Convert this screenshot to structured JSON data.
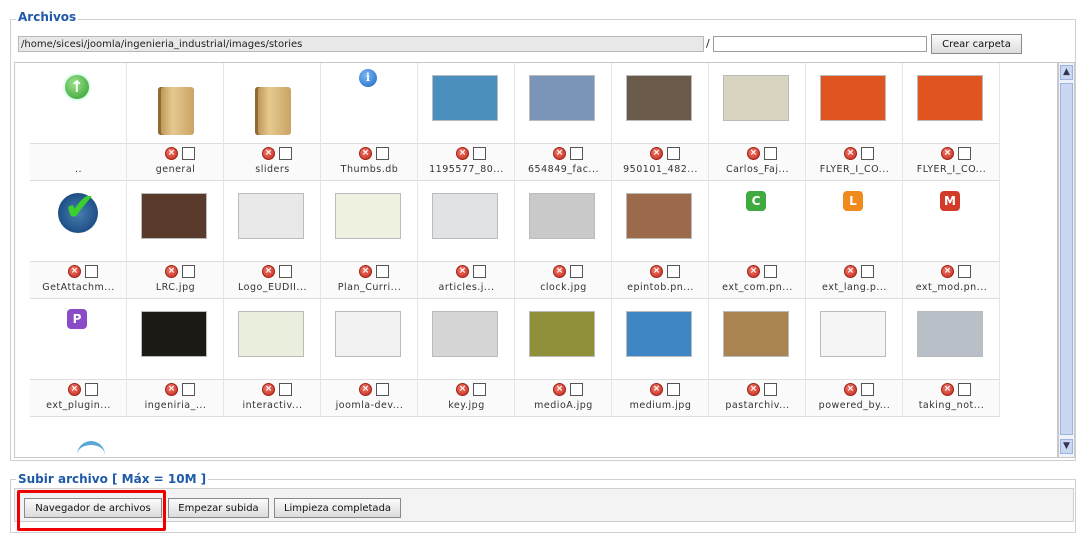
{
  "archivos": {
    "legend": "Archivos",
    "path": "/home/sicesi/joomla/ingenieria_industrial/images/stories",
    "slash": "/",
    "new_folder_value": "",
    "create_folder_label": "Crear carpeta"
  },
  "grid": {
    "rows": [
      [
        {
          "name": "..",
          "kind": "up",
          "icon": "up-arrow-icon",
          "actions": false
        },
        {
          "name": "general",
          "kind": "folder",
          "icon": "folder-icon",
          "actions": true
        },
        {
          "name": "sliders",
          "kind": "folder",
          "icon": "folder-icon",
          "actions": true
        },
        {
          "name": "Thumbs.db",
          "kind": "info",
          "icon": "info-icon",
          "actions": true
        },
        {
          "name": "1195577_80...",
          "kind": "photo",
          "icon": "handshake-photo",
          "color": "#4b8fbf",
          "actions": true
        },
        {
          "name": "654849_fac...",
          "kind": "photo",
          "icon": "factory-photo",
          "color": "#7b95b8",
          "actions": true
        },
        {
          "name": "950101_482...",
          "kind": "photo",
          "icon": "workers-photo",
          "color": "#6a5a4a",
          "actions": true
        },
        {
          "name": "Carlos_Faj...",
          "kind": "photo",
          "icon": "document-photo",
          "color": "#d9d4c0",
          "actions": true
        },
        {
          "name": "FLYER_I_CO...",
          "kind": "photo",
          "icon": "flyer-photo",
          "color": "#e0541f",
          "actions": true
        },
        {
          "name": "FLYER_I_CO...",
          "kind": "photo",
          "icon": "flyer-photo",
          "color": "#e0541f",
          "actions": true
        }
      ],
      [
        {
          "name": "GetAttachm...",
          "kind": "check",
          "icon": "checkmark-icon",
          "actions": true
        },
        {
          "name": "LRC.jpg",
          "kind": "photo",
          "icon": "portrait-photo",
          "color": "#5a3a2a",
          "actions": true
        },
        {
          "name": "Logo_EUDII...",
          "kind": "photo",
          "icon": "eudii-logo",
          "color": "#e8e8e8",
          "actions": true
        },
        {
          "name": "Plan_Curri...",
          "kind": "photo",
          "icon": "curriculum-photo",
          "color": "#eef0e0",
          "actions": true
        },
        {
          "name": "articles.j...",
          "kind": "photo",
          "icon": "articles-photo",
          "color": "#dfe3e6",
          "actions": true
        },
        {
          "name": "clock.jpg",
          "kind": "photo",
          "icon": "clock-photo",
          "color": "#c9c9c9",
          "actions": true
        },
        {
          "name": "epintob.pn...",
          "kind": "photo",
          "icon": "portrait-photo",
          "color": "#9a6a4a",
          "actions": true
        },
        {
          "name": "ext_com.pn...",
          "kind": "letter",
          "letter": "C",
          "color": "#3faa3f",
          "icon": "ext-com-icon",
          "actions": true
        },
        {
          "name": "ext_lang.p...",
          "kind": "letter",
          "letter": "L",
          "color": "#f08a1c",
          "icon": "ext-lang-icon",
          "actions": true
        },
        {
          "name": "ext_mod.pn...",
          "kind": "letter",
          "letter": "M",
          "color": "#d23a2a",
          "icon": "ext-mod-icon",
          "actions": true
        }
      ],
      [
        {
          "name": "ext_plugin...",
          "kind": "letter",
          "letter": "P",
          "color": "#8a4cc6",
          "icon": "ext-plugin-icon",
          "actions": true
        },
        {
          "name": "ingeniria_...",
          "kind": "photo",
          "icon": "night-city-photo",
          "color": "#1c1a14",
          "actions": true
        },
        {
          "name": "interactiv...",
          "kind": "photo",
          "icon": "interactive-logo",
          "color": "#e9efdc",
          "actions": true
        },
        {
          "name": "joomla-dev...",
          "kind": "photo",
          "icon": "joomla-circle",
          "color": "#f2f2f2",
          "actions": true
        },
        {
          "name": "key.jpg",
          "kind": "photo",
          "icon": "key-photo",
          "color": "#d6d6d6",
          "actions": true
        },
        {
          "name": "medioA.jpg",
          "kind": "photo",
          "icon": "handshake-photo",
          "color": "#8f8f3a",
          "actions": true
        },
        {
          "name": "medium.jpg",
          "kind": "photo",
          "icon": "puzzle-photo",
          "color": "#3e86c4",
          "actions": true
        },
        {
          "name": "pastarchiv...",
          "kind": "photo",
          "icon": "scroll-photo",
          "color": "#a98352",
          "actions": true
        },
        {
          "name": "powered_by...",
          "kind": "photo",
          "icon": "joomla-logo",
          "color": "#f5f5f5",
          "actions": true
        },
        {
          "name": "taking_not...",
          "kind": "photo",
          "icon": "computer-photo",
          "color": "#b9bfc7",
          "actions": true
        }
      ]
    ]
  },
  "upload": {
    "legend": "Subir archivo [ Máx = 10M ]",
    "browse_label": "Navegador de archivos",
    "start_label": "Empezar subida",
    "clear_label": "Limpieza completada"
  }
}
